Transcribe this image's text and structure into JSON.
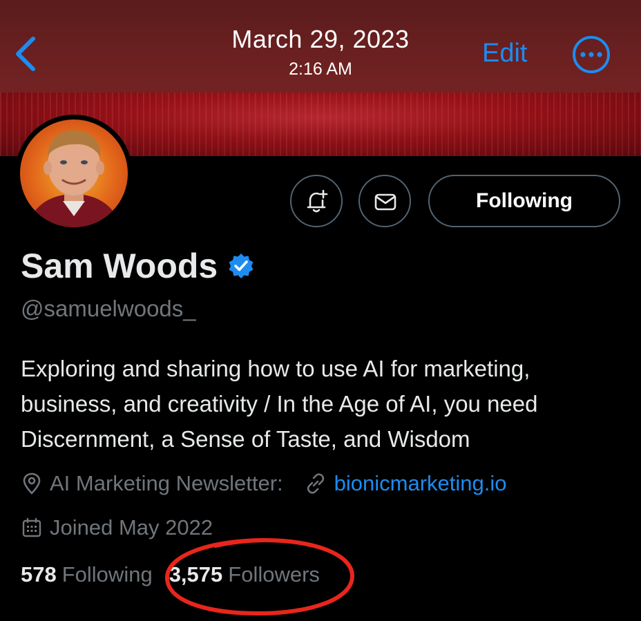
{
  "header": {
    "date": "March 29, 2023",
    "time": "2:16 AM",
    "edit_label": "Edit",
    "back_icon": "chevron-left-icon",
    "more_icon": "more-horizontal-icon"
  },
  "actions": {
    "notify_icon": "bell-plus-icon",
    "message_icon": "mail-icon",
    "following_label": "Following"
  },
  "profile": {
    "name": "Sam Woods",
    "handle": "@samuelwoods_",
    "bio": "Exploring and sharing how to use AI for marketing, business, and creativity / In the Age of AI, you need Discernment, a Sense of Taste, and Wisdom",
    "location": "AI Marketing Newsletter:",
    "website": "bionicmarketing.io",
    "joined": "Joined May 2022"
  },
  "stats": {
    "following_count": "578",
    "following_label": "Following",
    "followers_count": "3,575",
    "followers_label": "Followers"
  },
  "colors": {
    "accent": "#1d8cf0",
    "muted": "#71767b",
    "annotation": "#e8261b"
  }
}
